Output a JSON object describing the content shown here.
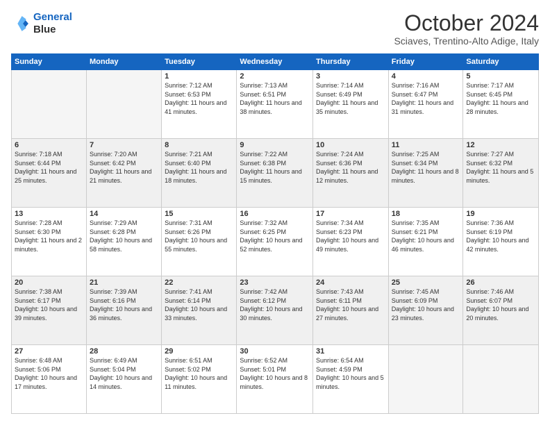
{
  "logo": {
    "line1": "General",
    "line2": "Blue"
  },
  "header": {
    "month": "October 2024",
    "location": "Sciaves, Trentino-Alto Adige, Italy"
  },
  "weekdays": [
    "Sunday",
    "Monday",
    "Tuesday",
    "Wednesday",
    "Thursday",
    "Friday",
    "Saturday"
  ],
  "weeks": [
    [
      {
        "day": "",
        "empty": true
      },
      {
        "day": "",
        "empty": true
      },
      {
        "day": "1",
        "sunrise": "7:12 AM",
        "sunset": "6:53 PM",
        "daylight": "11 hours and 41 minutes."
      },
      {
        "day": "2",
        "sunrise": "7:13 AM",
        "sunset": "6:51 PM",
        "daylight": "11 hours and 38 minutes."
      },
      {
        "day": "3",
        "sunrise": "7:14 AM",
        "sunset": "6:49 PM",
        "daylight": "11 hours and 35 minutes."
      },
      {
        "day": "4",
        "sunrise": "7:16 AM",
        "sunset": "6:47 PM",
        "daylight": "11 hours and 31 minutes."
      },
      {
        "day": "5",
        "sunrise": "7:17 AM",
        "sunset": "6:45 PM",
        "daylight": "11 hours and 28 minutes."
      }
    ],
    [
      {
        "day": "6",
        "sunrise": "7:18 AM",
        "sunset": "6:44 PM",
        "daylight": "11 hours and 25 minutes."
      },
      {
        "day": "7",
        "sunrise": "7:20 AM",
        "sunset": "6:42 PM",
        "daylight": "11 hours and 21 minutes."
      },
      {
        "day": "8",
        "sunrise": "7:21 AM",
        "sunset": "6:40 PM",
        "daylight": "11 hours and 18 minutes."
      },
      {
        "day": "9",
        "sunrise": "7:22 AM",
        "sunset": "6:38 PM",
        "daylight": "11 hours and 15 minutes."
      },
      {
        "day": "10",
        "sunrise": "7:24 AM",
        "sunset": "6:36 PM",
        "daylight": "11 hours and 12 minutes."
      },
      {
        "day": "11",
        "sunrise": "7:25 AM",
        "sunset": "6:34 PM",
        "daylight": "11 hours and 8 minutes."
      },
      {
        "day": "12",
        "sunrise": "7:27 AM",
        "sunset": "6:32 PM",
        "daylight": "11 hours and 5 minutes."
      }
    ],
    [
      {
        "day": "13",
        "sunrise": "7:28 AM",
        "sunset": "6:30 PM",
        "daylight": "11 hours and 2 minutes."
      },
      {
        "day": "14",
        "sunrise": "7:29 AM",
        "sunset": "6:28 PM",
        "daylight": "10 hours and 58 minutes."
      },
      {
        "day": "15",
        "sunrise": "7:31 AM",
        "sunset": "6:26 PM",
        "daylight": "10 hours and 55 minutes."
      },
      {
        "day": "16",
        "sunrise": "7:32 AM",
        "sunset": "6:25 PM",
        "daylight": "10 hours and 52 minutes."
      },
      {
        "day": "17",
        "sunrise": "7:34 AM",
        "sunset": "6:23 PM",
        "daylight": "10 hours and 49 minutes."
      },
      {
        "day": "18",
        "sunrise": "7:35 AM",
        "sunset": "6:21 PM",
        "daylight": "10 hours and 46 minutes."
      },
      {
        "day": "19",
        "sunrise": "7:36 AM",
        "sunset": "6:19 PM",
        "daylight": "10 hours and 42 minutes."
      }
    ],
    [
      {
        "day": "20",
        "sunrise": "7:38 AM",
        "sunset": "6:17 PM",
        "daylight": "10 hours and 39 minutes."
      },
      {
        "day": "21",
        "sunrise": "7:39 AM",
        "sunset": "6:16 PM",
        "daylight": "10 hours and 36 minutes."
      },
      {
        "day": "22",
        "sunrise": "7:41 AM",
        "sunset": "6:14 PM",
        "daylight": "10 hours and 33 minutes."
      },
      {
        "day": "23",
        "sunrise": "7:42 AM",
        "sunset": "6:12 PM",
        "daylight": "10 hours and 30 minutes."
      },
      {
        "day": "24",
        "sunrise": "7:43 AM",
        "sunset": "6:11 PM",
        "daylight": "10 hours and 27 minutes."
      },
      {
        "day": "25",
        "sunrise": "7:45 AM",
        "sunset": "6:09 PM",
        "daylight": "10 hours and 23 minutes."
      },
      {
        "day": "26",
        "sunrise": "7:46 AM",
        "sunset": "6:07 PM",
        "daylight": "10 hours and 20 minutes."
      }
    ],
    [
      {
        "day": "27",
        "sunrise": "6:48 AM",
        "sunset": "5:06 PM",
        "daylight": "10 hours and 17 minutes."
      },
      {
        "day": "28",
        "sunrise": "6:49 AM",
        "sunset": "5:04 PM",
        "daylight": "10 hours and 14 minutes."
      },
      {
        "day": "29",
        "sunrise": "6:51 AM",
        "sunset": "5:02 PM",
        "daylight": "10 hours and 11 minutes."
      },
      {
        "day": "30",
        "sunrise": "6:52 AM",
        "sunset": "5:01 PM",
        "daylight": "10 hours and 8 minutes."
      },
      {
        "day": "31",
        "sunrise": "6:54 AM",
        "sunset": "4:59 PM",
        "daylight": "10 hours and 5 minutes."
      },
      {
        "day": "",
        "empty": true
      },
      {
        "day": "",
        "empty": true
      }
    ]
  ],
  "labels": {
    "sunrise": "Sunrise:",
    "sunset": "Sunset:",
    "daylight": "Daylight:"
  }
}
